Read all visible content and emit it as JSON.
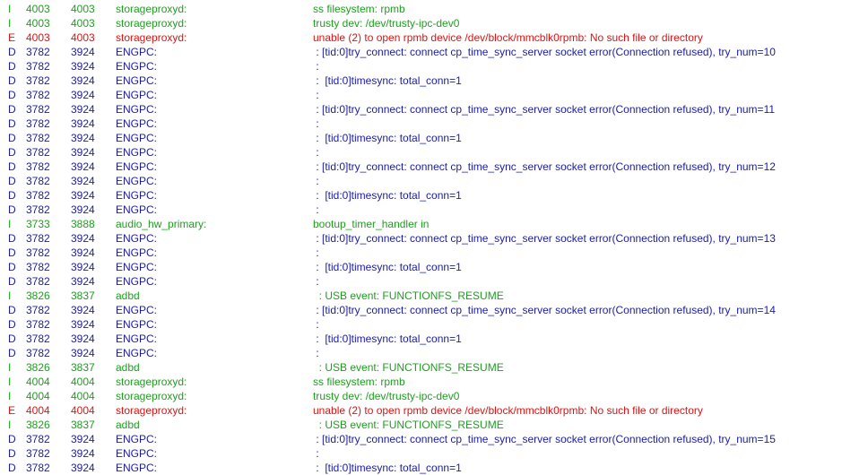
{
  "colors": {
    "info": "#1f9e1f",
    "debug": "#1c1ca8",
    "error": "#e01212",
    "background": "#ffffff"
  },
  "log": {
    "rows": [
      {
        "level": "I",
        "pid": "4003",
        "tid": "4003",
        "tag": "storageproxyd:",
        "message": "ss filesystem: rpmb"
      },
      {
        "level": "I",
        "pid": "4003",
        "tid": "4003",
        "tag": "storageproxyd:",
        "message": "trusty dev: /dev/trusty-ipc-dev0"
      },
      {
        "level": "E",
        "pid": "4003",
        "tid": "4003",
        "tag": "storageproxyd:",
        "message": "unable (2) to open rpmb device /dev/block/mmcblk0rpmb: No such file or directory"
      },
      {
        "level": "D",
        "pid": "3782",
        "tid": "3924",
        "tag": "ENGPC:",
        "message": " : [tid:0]try_connect: connect cp_time_sync_server socket error(Connection refused), try_num=10"
      },
      {
        "level": "D",
        "pid": "3782",
        "tid": "3924",
        "tag": "ENGPC:",
        "message": " :"
      },
      {
        "level": "D",
        "pid": "3782",
        "tid": "3924",
        "tag": "ENGPC:",
        "message": " :  [tid:0]timesync: total_conn=1"
      },
      {
        "level": "D",
        "pid": "3782",
        "tid": "3924",
        "tag": "ENGPC:",
        "message": " :"
      },
      {
        "level": "D",
        "pid": "3782",
        "tid": "3924",
        "tag": "ENGPC:",
        "message": " : [tid:0]try_connect: connect cp_time_sync_server socket error(Connection refused), try_num=11"
      },
      {
        "level": "D",
        "pid": "3782",
        "tid": "3924",
        "tag": "ENGPC:",
        "message": " :"
      },
      {
        "level": "D",
        "pid": "3782",
        "tid": "3924",
        "tag": "ENGPC:",
        "message": " :  [tid:0]timesync: total_conn=1"
      },
      {
        "level": "D",
        "pid": "3782",
        "tid": "3924",
        "tag": "ENGPC:",
        "message": " :"
      },
      {
        "level": "D",
        "pid": "3782",
        "tid": "3924",
        "tag": "ENGPC:",
        "message": " : [tid:0]try_connect: connect cp_time_sync_server socket error(Connection refused), try_num=12"
      },
      {
        "level": "D",
        "pid": "3782",
        "tid": "3924",
        "tag": "ENGPC:",
        "message": " :"
      },
      {
        "level": "D",
        "pid": "3782",
        "tid": "3924",
        "tag": "ENGPC:",
        "message": " :  [tid:0]timesync: total_conn=1"
      },
      {
        "level": "D",
        "pid": "3782",
        "tid": "3924",
        "tag": "ENGPC:",
        "message": " :"
      },
      {
        "level": "I",
        "pid": "3733",
        "tid": "3888",
        "tag": "audio_hw_primary:",
        "message": "bootup_timer_handler in"
      },
      {
        "level": "D",
        "pid": "3782",
        "tid": "3924",
        "tag": "ENGPC:",
        "message": " : [tid:0]try_connect: connect cp_time_sync_server socket error(Connection refused), try_num=13"
      },
      {
        "level": "D",
        "pid": "3782",
        "tid": "3924",
        "tag": "ENGPC:",
        "message": " :"
      },
      {
        "level": "D",
        "pid": "3782",
        "tid": "3924",
        "tag": "ENGPC:",
        "message": " :  [tid:0]timesync: total_conn=1"
      },
      {
        "level": "D",
        "pid": "3782",
        "tid": "3924",
        "tag": "ENGPC:",
        "message": " :"
      },
      {
        "level": "I",
        "pid": "3826",
        "tid": "3837",
        "tag": "adbd",
        "message": "  : USB event: FUNCTIONFS_RESUME"
      },
      {
        "level": "D",
        "pid": "3782",
        "tid": "3924",
        "tag": "ENGPC:",
        "message": " : [tid:0]try_connect: connect cp_time_sync_server socket error(Connection refused), try_num=14"
      },
      {
        "level": "D",
        "pid": "3782",
        "tid": "3924",
        "tag": "ENGPC:",
        "message": " :"
      },
      {
        "level": "D",
        "pid": "3782",
        "tid": "3924",
        "tag": "ENGPC:",
        "message": " :  [tid:0]timesync: total_conn=1"
      },
      {
        "level": "D",
        "pid": "3782",
        "tid": "3924",
        "tag": "ENGPC:",
        "message": " :"
      },
      {
        "level": "I",
        "pid": "3826",
        "tid": "3837",
        "tag": "adbd",
        "message": "  : USB event: FUNCTIONFS_RESUME"
      },
      {
        "level": "I",
        "pid": "4004",
        "tid": "4004",
        "tag": "storageproxyd:",
        "message": "ss filesystem: rpmb"
      },
      {
        "level": "I",
        "pid": "4004",
        "tid": "4004",
        "tag": "storageproxyd:",
        "message": "trusty dev: /dev/trusty-ipc-dev0"
      },
      {
        "level": "E",
        "pid": "4004",
        "tid": "4004",
        "tag": "storageproxyd:",
        "message": "unable (2) to open rpmb device /dev/block/mmcblk0rpmb: No such file or directory"
      },
      {
        "level": "I",
        "pid": "3826",
        "tid": "3837",
        "tag": "adbd",
        "message": "  : USB event: FUNCTIONFS_RESUME"
      },
      {
        "level": "D",
        "pid": "3782",
        "tid": "3924",
        "tag": "ENGPC:",
        "message": " : [tid:0]try_connect: connect cp_time_sync_server socket error(Connection refused), try_num=15"
      },
      {
        "level": "D",
        "pid": "3782",
        "tid": "3924",
        "tag": "ENGPC:",
        "message": " :"
      },
      {
        "level": "D",
        "pid": "3782",
        "tid": "3924",
        "tag": "ENGPC:",
        "message": " :  [tid:0]timesync: total_conn=1"
      }
    ]
  }
}
